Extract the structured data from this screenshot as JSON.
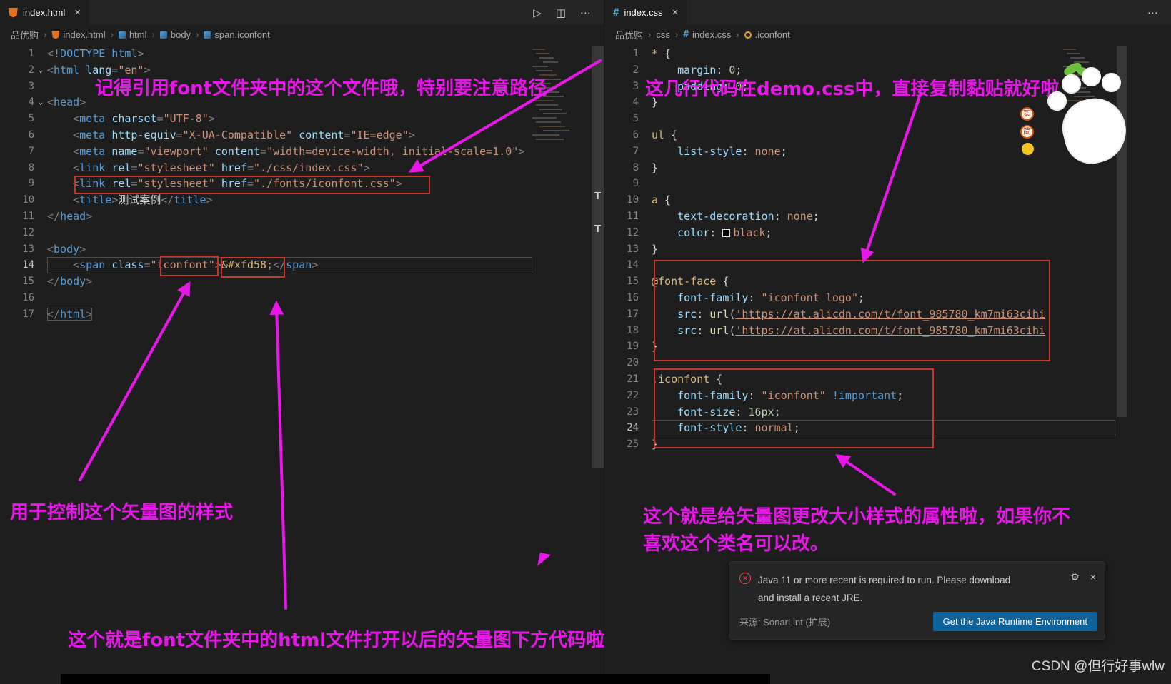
{
  "colors": {
    "magenta": "#e916e9",
    "red_box": "#c0392b",
    "button_blue": "#0e639c"
  },
  "glyphs": {
    "close": "×",
    "run": "▷",
    "split": "◫",
    "more": "⋯",
    "fold": "⌄",
    "gear": "⚙",
    "css_icon": "#",
    "error": "✕"
  },
  "left_pane": {
    "tab": {
      "label": "index.html"
    },
    "actions": {
      "run": "▷",
      "split": "◫",
      "more": "⋯"
    },
    "breadcrumb": [
      {
        "label": "品优购",
        "icon": ""
      },
      {
        "label": "index.html",
        "icon": "html"
      },
      {
        "label": "html",
        "icon": "cube"
      },
      {
        "label": "body",
        "icon": "cube"
      },
      {
        "label": "span.iconfont",
        "icon": "cube"
      }
    ],
    "current_line": 14,
    "lines": [
      {
        "n": 1,
        "s": [
          [
            "<",
            "p"
          ],
          [
            "!DOCTYPE",
            "kw"
          ],
          [
            " html",
            "kw"
          ],
          [
            ">",
            "p"
          ]
        ]
      },
      {
        "n": 2,
        "fold": true,
        "s": [
          [
            "<",
            "p"
          ],
          [
            "html",
            "tag"
          ],
          [
            " ",
            "tx"
          ],
          [
            "lang",
            "attr"
          ],
          [
            "=",
            "p"
          ],
          [
            "\"en\"",
            "str"
          ],
          [
            ">",
            "p"
          ]
        ]
      },
      {
        "n": 3,
        "s": []
      },
      {
        "n": 4,
        "fold": true,
        "s": [
          [
            "<",
            "p"
          ],
          [
            "head",
            "tag"
          ],
          [
            ">",
            "p"
          ]
        ]
      },
      {
        "n": 5,
        "s": [
          [
            "    ",
            "tx"
          ],
          [
            "<",
            "p"
          ],
          [
            "meta",
            "tag"
          ],
          [
            " ",
            "tx"
          ],
          [
            "charset",
            "attr"
          ],
          [
            "=",
            "p"
          ],
          [
            "\"UTF-8\"",
            "str"
          ],
          [
            ">",
            "p"
          ]
        ]
      },
      {
        "n": 6,
        "s": [
          [
            "    ",
            "tx"
          ],
          [
            "<",
            "p"
          ],
          [
            "meta",
            "tag"
          ],
          [
            " ",
            "tx"
          ],
          [
            "http-equiv",
            "attr"
          ],
          [
            "=",
            "p"
          ],
          [
            "\"X-UA-Compatible\"",
            "str"
          ],
          [
            " ",
            "tx"
          ],
          [
            "content",
            "attr"
          ],
          [
            "=",
            "p"
          ],
          [
            "\"IE=edge\"",
            "str"
          ],
          [
            ">",
            "p"
          ]
        ]
      },
      {
        "n": 7,
        "s": [
          [
            "    ",
            "tx"
          ],
          [
            "<",
            "p"
          ],
          [
            "meta",
            "tag"
          ],
          [
            " ",
            "tx"
          ],
          [
            "name",
            "attr"
          ],
          [
            "=",
            "p"
          ],
          [
            "\"viewport\"",
            "str"
          ],
          [
            " ",
            "tx"
          ],
          [
            "content",
            "attr"
          ],
          [
            "=",
            "p"
          ],
          [
            "\"width=device-width, initial-scale=1.0\"",
            "str"
          ],
          [
            ">",
            "p"
          ]
        ]
      },
      {
        "n": 8,
        "s": [
          [
            "    ",
            "tx"
          ],
          [
            "<",
            "p"
          ],
          [
            "link",
            "tag"
          ],
          [
            " ",
            "tx"
          ],
          [
            "rel",
            "attr"
          ],
          [
            "=",
            "p"
          ],
          [
            "\"stylesheet\"",
            "str"
          ],
          [
            " ",
            "tx"
          ],
          [
            "href",
            "attr"
          ],
          [
            "=",
            "p"
          ],
          [
            "\"./css/index.css\"",
            "str"
          ],
          [
            ">",
            "p"
          ]
        ]
      },
      {
        "n": 9,
        "s": [
          [
            "    ",
            "tx"
          ],
          [
            "<",
            "p"
          ],
          [
            "link",
            "tag"
          ],
          [
            " ",
            "tx"
          ],
          [
            "rel",
            "attr"
          ],
          [
            "=",
            "p"
          ],
          [
            "\"stylesheet\"",
            "str"
          ],
          [
            " ",
            "tx"
          ],
          [
            "href",
            "attr"
          ],
          [
            "=",
            "p"
          ],
          [
            "\"./fonts/iconfont.css\"",
            "str"
          ],
          [
            ">",
            "p"
          ]
        ]
      },
      {
        "n": 10,
        "s": [
          [
            "    ",
            "tx"
          ],
          [
            "<",
            "p"
          ],
          [
            "title",
            "tag"
          ],
          [
            ">",
            "p"
          ],
          [
            "测试案例",
            "tx"
          ],
          [
            "</",
            "p"
          ],
          [
            "title",
            "tag"
          ],
          [
            ">",
            "p"
          ]
        ]
      },
      {
        "n": 11,
        "s": [
          [
            "</",
            "p"
          ],
          [
            "head",
            "tag"
          ],
          [
            ">",
            "p"
          ]
        ]
      },
      {
        "n": 12,
        "s": []
      },
      {
        "n": 13,
        "s": [
          [
            "<",
            "p"
          ],
          [
            "body",
            "tag"
          ],
          [
            ">",
            "p"
          ]
        ]
      },
      {
        "n": 14,
        "s": [
          [
            "    ",
            "tx"
          ],
          [
            "<",
            "p"
          ],
          [
            "span",
            "tag"
          ],
          [
            " ",
            "tx"
          ],
          [
            "class",
            "attr"
          ],
          [
            "=",
            "p"
          ],
          [
            "\"iconfont\"",
            "str"
          ],
          [
            ">",
            "p"
          ],
          [
            "&#xfd58;",
            "ent"
          ],
          [
            "</",
            "p"
          ],
          [
            "span",
            "tag"
          ],
          [
            ">",
            "p"
          ]
        ]
      },
      {
        "n": 15,
        "s": [
          [
            "</",
            "p"
          ],
          [
            "body",
            "tag"
          ],
          [
            ">",
            "p"
          ]
        ]
      },
      {
        "n": 16,
        "s": []
      },
      {
        "n": 17,
        "box": true,
        "s": [
          [
            "</",
            "p"
          ],
          [
            "html",
            "tag"
          ],
          [
            ">",
            "p"
          ]
        ]
      }
    ]
  },
  "right_pane": {
    "tab": {
      "label": "index.css"
    },
    "actions": {
      "more": "⋯"
    },
    "breadcrumb": [
      {
        "label": "品优购",
        "icon": ""
      },
      {
        "label": "css",
        "icon": ""
      },
      {
        "label": "index.css",
        "icon": "css"
      },
      {
        "label": ".iconfont",
        "icon": "class"
      }
    ],
    "current_line": 24,
    "lines": [
      {
        "n": 1,
        "s": [
          [
            "*",
            "sel"
          ],
          [
            " {",
            "br"
          ]
        ]
      },
      {
        "n": 2,
        "s": [
          [
            "    ",
            "tx"
          ],
          [
            "margin",
            "attr"
          ],
          [
            ":",
            "br"
          ],
          [
            " ",
            "tx"
          ],
          [
            "0",
            "num"
          ],
          [
            ";",
            "br"
          ]
        ]
      },
      {
        "n": 3,
        "s": [
          [
            "    ",
            "tx"
          ],
          [
            "padding",
            "attr"
          ],
          [
            ":",
            "br"
          ],
          [
            " ",
            "tx"
          ],
          [
            "0",
            "num"
          ],
          [
            ";",
            "br"
          ]
        ]
      },
      {
        "n": 4,
        "s": [
          [
            "}",
            "br"
          ]
        ]
      },
      {
        "n": 5,
        "s": []
      },
      {
        "n": 6,
        "s": [
          [
            "ul",
            "sel"
          ],
          [
            " {",
            "br"
          ]
        ]
      },
      {
        "n": 7,
        "s": [
          [
            "    ",
            "tx"
          ],
          [
            "list-style",
            "attr"
          ],
          [
            ":",
            "br"
          ],
          [
            " ",
            "tx"
          ],
          [
            "none",
            "val"
          ],
          [
            ";",
            "br"
          ]
        ]
      },
      {
        "n": 8,
        "s": [
          [
            "}",
            "br"
          ]
        ]
      },
      {
        "n": 9,
        "s": []
      },
      {
        "n": 10,
        "s": [
          [
            "a",
            "sel"
          ],
          [
            " {",
            "br"
          ]
        ]
      },
      {
        "n": 11,
        "s": [
          [
            "    ",
            "tx"
          ],
          [
            "text-decoration",
            "attr"
          ],
          [
            ":",
            "br"
          ],
          [
            " ",
            "tx"
          ],
          [
            "none",
            "val"
          ],
          [
            ";",
            "br"
          ]
        ]
      },
      {
        "n": 12,
        "s": [
          [
            "    ",
            "tx"
          ],
          [
            "color",
            "attr"
          ],
          [
            ":",
            "br"
          ],
          [
            " ",
            "tx"
          ],
          [
            "",
            "swatch"
          ],
          [
            "black",
            "val"
          ],
          [
            ";",
            "br"
          ]
        ]
      },
      {
        "n": 13,
        "s": [
          [
            "}",
            "br"
          ]
        ]
      },
      {
        "n": 14,
        "s": []
      },
      {
        "n": 15,
        "s": [
          [
            "@font-face",
            "sel"
          ],
          [
            " {",
            "br"
          ]
        ]
      },
      {
        "n": 16,
        "s": [
          [
            "    ",
            "tx"
          ],
          [
            "font-family",
            "attr"
          ],
          [
            ":",
            "br"
          ],
          [
            " ",
            "tx"
          ],
          [
            "\"iconfont logo\"",
            "str"
          ],
          [
            ";",
            "br"
          ]
        ]
      },
      {
        "n": 17,
        "s": [
          [
            "    ",
            "tx"
          ],
          [
            "src",
            "attr"
          ],
          [
            ":",
            "br"
          ],
          [
            " ",
            "tx"
          ],
          [
            "url",
            "fn"
          ],
          [
            "(",
            "br"
          ],
          [
            "'https://at.alicdn.com/t/font_985780_km7mi63cihi",
            "url"
          ]
        ]
      },
      {
        "n": 18,
        "s": [
          [
            "    ",
            "tx"
          ],
          [
            "src",
            "attr"
          ],
          [
            ":",
            "br"
          ],
          [
            " ",
            "tx"
          ],
          [
            "url",
            "fn"
          ],
          [
            "(",
            "br"
          ],
          [
            "'https://at.alicdn.com/t/font_985780_km7mi63cihi",
            "url"
          ]
        ]
      },
      {
        "n": 19,
        "s": [
          [
            "}",
            "br"
          ]
        ]
      },
      {
        "n": 20,
        "s": []
      },
      {
        "n": 21,
        "s": [
          [
            ".iconfont",
            "sel"
          ],
          [
            " {",
            "br"
          ]
        ]
      },
      {
        "n": 22,
        "s": [
          [
            "    ",
            "tx"
          ],
          [
            "font-family",
            "attr"
          ],
          [
            ":",
            "br"
          ],
          [
            " ",
            "tx"
          ],
          [
            "\"iconfont\"",
            "str"
          ],
          [
            " ",
            "tx"
          ],
          [
            "!important",
            "imp"
          ],
          [
            ";",
            "br"
          ]
        ]
      },
      {
        "n": 23,
        "s": [
          [
            "    ",
            "tx"
          ],
          [
            "font-size",
            "attr"
          ],
          [
            ":",
            "br"
          ],
          [
            " ",
            "tx"
          ],
          [
            "16px",
            "num"
          ],
          [
            ";",
            "br"
          ]
        ]
      },
      {
        "n": 24,
        "s": [
          [
            "    ",
            "tx"
          ],
          [
            "font-style",
            "attr"
          ],
          [
            ":",
            "br"
          ],
          [
            " ",
            "tx"
          ],
          [
            "normal",
            "val"
          ],
          [
            ";",
            "br"
          ]
        ]
      },
      {
        "n": 25,
        "s": [
          [
            "}",
            "br"
          ]
        ]
      }
    ]
  },
  "annotations": {
    "left_top": "记得引用font文件夹中的这个文件哦，特别要注意路径",
    "left_mid": "用于控制这个矢量图的样式",
    "left_bottom": "这个就是font文件夹中的html文件打开以后的矢量图下方代码啦",
    "right_top": "这几行代码在demo.css中，直接复制黏贴就好啦",
    "right_bottom_line1": "这个就是给矢量图更改大小样式的属性啦，如果你不",
    "right_bottom_line2": "喜欢这个类名可以改。"
  },
  "stickers": {
    "badge1": "实",
    "badge2": "简"
  },
  "notification": {
    "message_line1": "Java 11 or more recent is required to run. Please download",
    "message_line2": "and install a recent JRE.",
    "source": "来源: SonarLint (扩展)",
    "button_label": "Get the Java Runtime Environment"
  },
  "watermark": "CSDN @但行好事wlw"
}
